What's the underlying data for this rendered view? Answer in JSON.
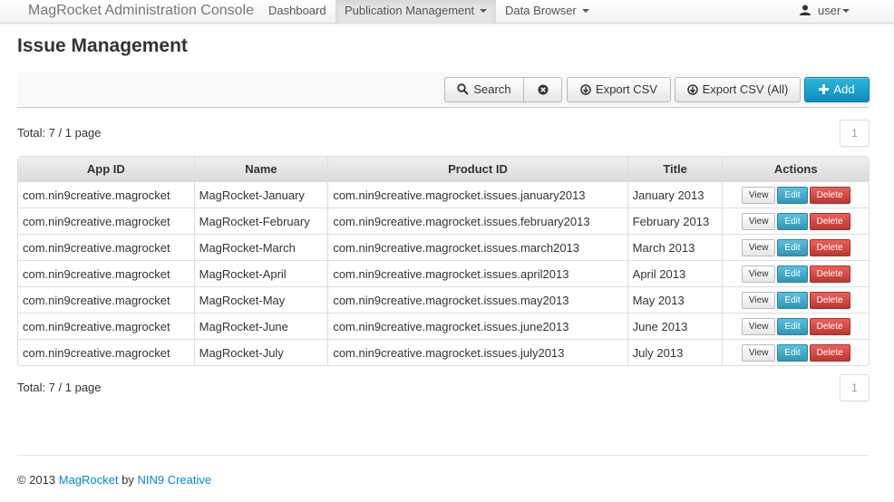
{
  "navbar": {
    "brand": "MagRocket Administration Console",
    "items": [
      {
        "label": "Dashboard"
      },
      {
        "label": "Publication Management"
      },
      {
        "label": "Data Browser"
      }
    ],
    "user": "user"
  },
  "page": {
    "title": "Issue Management"
  },
  "toolbar": {
    "search": "Search",
    "export_csv": "Export CSV",
    "export_csv_all": "Export CSV (All)",
    "add": "Add"
  },
  "pagination": {
    "total_text": "Total: 7 / 1 page",
    "page": "1"
  },
  "table": {
    "columns": [
      "App ID",
      "Name",
      "Product ID",
      "Title",
      "Actions"
    ],
    "rows": [
      {
        "app_id": "com.nin9creative.magrocket",
        "name": "MagRocket-January",
        "product_id": "com.nin9creative.magrocket.issues.january2013",
        "title": "January 2013"
      },
      {
        "app_id": "com.nin9creative.magrocket",
        "name": "MagRocket-February",
        "product_id": "com.nin9creative.magrocket.issues.february2013",
        "title": "February 2013"
      },
      {
        "app_id": "com.nin9creative.magrocket",
        "name": "MagRocket-March",
        "product_id": "com.nin9creative.magrocket.issues.march2013",
        "title": "March 2013"
      },
      {
        "app_id": "com.nin9creative.magrocket",
        "name": "MagRocket-April",
        "product_id": "com.nin9creative.magrocket.issues.april2013",
        "title": "April 2013"
      },
      {
        "app_id": "com.nin9creative.magrocket",
        "name": "MagRocket-May",
        "product_id": "com.nin9creative.magrocket.issues.may2013",
        "title": "May 2013"
      },
      {
        "app_id": "com.nin9creative.magrocket",
        "name": "MagRocket-June",
        "product_id": "com.nin9creative.magrocket.issues.june2013",
        "title": "June 2013"
      },
      {
        "app_id": "com.nin9creative.magrocket",
        "name": "MagRocket-July",
        "product_id": "com.nin9creative.magrocket.issues.july2013",
        "title": "July 2013"
      }
    ],
    "actions": {
      "view": "View",
      "edit": "Edit",
      "delete": "Delete"
    }
  },
  "footer": {
    "prefix": "© 2013",
    "magrocket": "MagRocket",
    "by": "by",
    "company": "NIN9 Creative"
  },
  "icons": [
    "user-icon",
    "search-icon",
    "clear-icon",
    "download-icon",
    "plus-icon",
    "caret-down-icon"
  ],
  "colors": {
    "primary": "#0a8ec2",
    "info": "#2f96b4",
    "danger": "#bd362f",
    "link": "#0088cc"
  }
}
